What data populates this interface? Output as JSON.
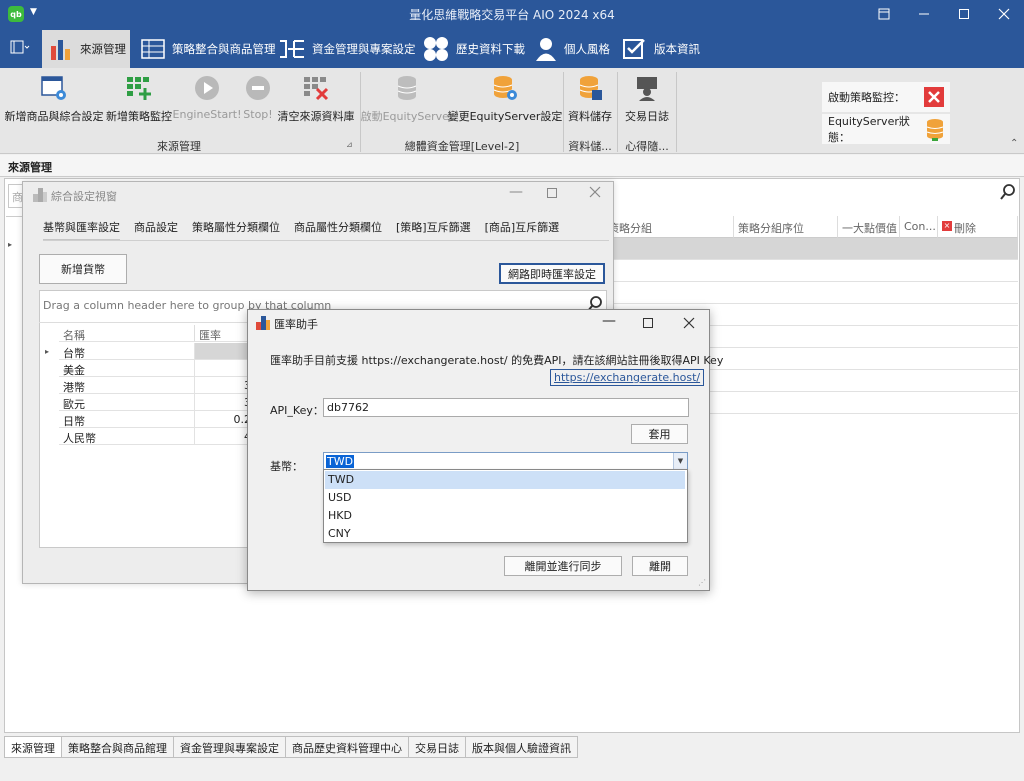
{
  "app": {
    "title": "量化思維戰略交易平台 AIO 2024 x64",
    "logo_text": "qb"
  },
  "ribbon_tabs": [
    {
      "label": "來源管理"
    },
    {
      "label": "策略整合與商品管理"
    },
    {
      "label": "資金管理與專案設定"
    },
    {
      "label": "歷史資料下載"
    },
    {
      "label": "個人風格"
    },
    {
      "label": "版本資訊"
    }
  ],
  "ribbon": {
    "buttons": [
      {
        "label": "新增商品與綜合設定",
        "icon": "window-gear-icon"
      },
      {
        "label": "新增策略監控",
        "icon": "grid-add-icon"
      },
      {
        "label": "EngineStart!",
        "icon": "play-icon"
      },
      {
        "label": "Stop!",
        "icon": "stop-icon"
      },
      {
        "label": "清空來源資料庫",
        "icon": "grid-delete-icon"
      },
      {
        "label": "啟動EquityServer",
        "icon": "database-icon"
      },
      {
        "label": "變更EquityServer設定",
        "icon": "database-gear-icon"
      },
      {
        "label": "資料儲存",
        "icon": "database-save-icon"
      },
      {
        "label": "交易日誌",
        "icon": "teacher-icon"
      }
    ],
    "groups": [
      "來源管理",
      "總體資金管理[Level-2]",
      "資料儲...",
      "心得隨..."
    ],
    "status": {
      "monitor_label": "啟動策略監控：",
      "equity_label": "EquityServer狀態："
    }
  },
  "panel": {
    "title": "來源管理",
    "search_placeholder": "商"
  },
  "grid": {
    "columns": [
      "策略分組",
      "策略分組序位",
      "一大點價值",
      "Con...",
      "刪除"
    ]
  },
  "bottom_tabs": [
    "來源管理",
    "策略整合與商品館理",
    "資金管理與專案設定",
    "商品歷史資料管理中心",
    "交易日誌",
    "版本與個人驗證資訊"
  ],
  "settings_window": {
    "title": "綜合設定視窗",
    "tabs": [
      "基幣與匯率設定",
      "商品設定",
      "策略屬性分類欄位",
      "商品屬性分類欄位",
      "[策略]互斥篩選",
      "[商品]互斥篩選"
    ],
    "add_currency": "新增貨幣",
    "online_rate": "網路即時匯率設定",
    "group_hint": "Drag a column header here to group by that column",
    "columns": [
      "名稱",
      "匯率"
    ],
    "rows": [
      {
        "name": "台幣",
        "rate": ""
      },
      {
        "name": "美金",
        "rate": ""
      },
      {
        "name": "港幣",
        "rate": "3"
      },
      {
        "name": "歐元",
        "rate": "3"
      },
      {
        "name": "日幣",
        "rate": "0.2"
      },
      {
        "name": "人民幣",
        "rate": "4"
      }
    ]
  },
  "rate_dialog": {
    "title": "匯率助手",
    "description": "匯率助手目前支援 https://exchangerate.host/ 的免費API，請在該網站註冊後取得API Key",
    "link": "https://exchangerate.host/",
    "api_key_label": "API_Key：",
    "api_key_value": "db7762",
    "apply": "套用",
    "base_label": "基幣：",
    "base_value": "TWD",
    "options": [
      "TWD",
      "USD",
      "HKD",
      "CNY"
    ],
    "sync_close": "離開並進行同步",
    "close": "離開"
  },
  "colors": {
    "titlebar": "#2b579a",
    "ribbon": "#e6e6e6",
    "selection": "#cde0f7",
    "danger": "#e23b3b",
    "db_orange": "#f0a23a"
  }
}
